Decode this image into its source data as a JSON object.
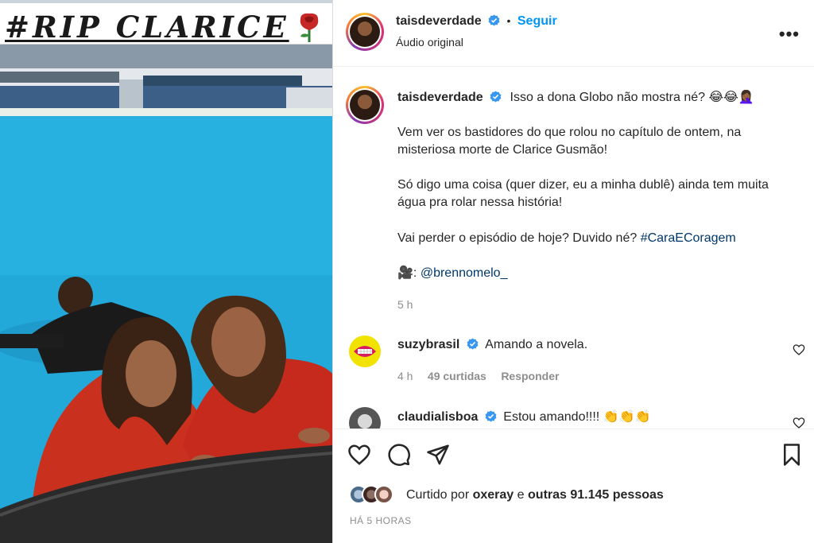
{
  "media": {
    "banner_text": "#RIP CLARICE",
    "rose_icon": "rose-emoji"
  },
  "header": {
    "username": "taisdeverdade",
    "follow_label": "Seguir",
    "separator": "•",
    "audio_label": "Áudio original",
    "more_icon": "more-options-icon"
  },
  "post": {
    "username": "taisdeverdade",
    "first_line": "Isso a dona Globo não mostra né?",
    "first_line_emojis": "😂😂🤦🏾‍♀️",
    "para2_line1": "Vem ver os bastidores do que rolou no capítulo de ontem, na",
    "para2_line2": "misteriosa morte de Clarice Gusmão!",
    "para3_line1": "Só digo uma coisa (quer dizer, eu a minha dublê) ainda tem muita",
    "para3_line2": "água pra rolar nessa história!",
    "para4_text": "Vai perder o episódio de hoje? Duvido né?",
    "para4_hashtag": "#CaraECoragem",
    "credit_emoji": "🎥",
    "credit_prefix": ":",
    "credit_mention": "@brennomelo_",
    "time": "5 h"
  },
  "comments": [
    {
      "username": "suzybrasil",
      "text": "Amando a novela.",
      "time": "4 h",
      "likes": "49 curtidas",
      "reply": "Responder"
    },
    {
      "username": "claudialisboa",
      "text": "Estou amando!!!!",
      "emojis": "👏👏👏"
    }
  ],
  "actions": {
    "like_icon": "heart-icon",
    "comment_icon": "comment-icon",
    "share_icon": "share-icon",
    "save_icon": "bookmark-icon"
  },
  "likes": {
    "prefix": "Curtido por",
    "user": "oxeray",
    "middle": "e",
    "others": "outras 91.145 pessoas"
  },
  "posted_ago": "HÁ 5 HORAS",
  "colors": {
    "link_blue": "#0095f6",
    "hashtag_blue": "#00376b",
    "meta_gray": "#8e8e8e",
    "verified_blue": "#3897f0"
  }
}
